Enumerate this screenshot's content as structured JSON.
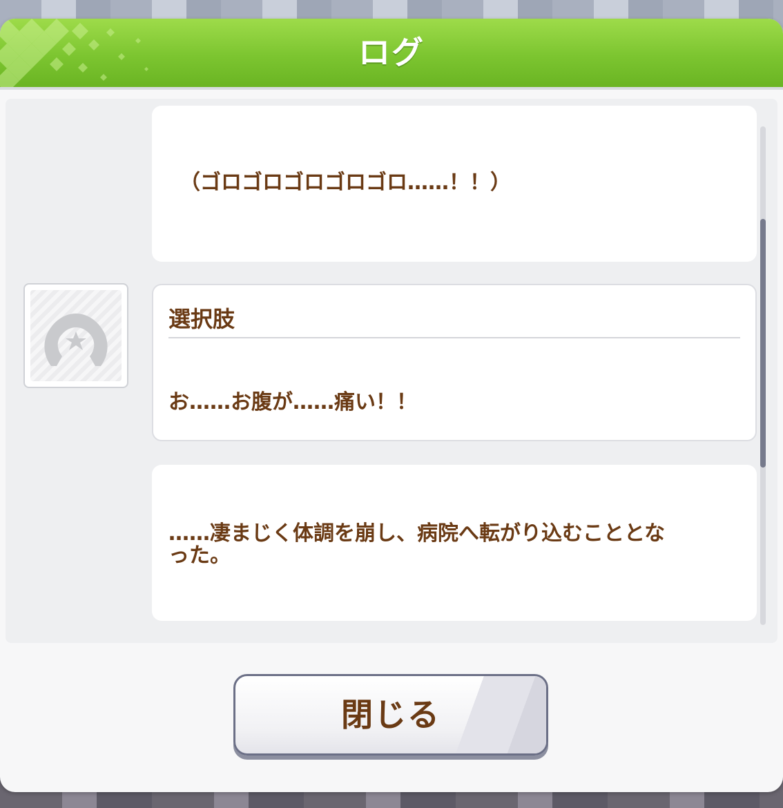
{
  "dialog": {
    "title": "ログ"
  },
  "log": {
    "entries": [
      {
        "type": "narration",
        "text": "（ゴロゴロゴロゴロゴロ……！！）"
      },
      {
        "type": "choice",
        "label": "選択肢",
        "text": "お……お腹が……痛い！！"
      },
      {
        "type": "narration",
        "text": "……凄まじく体調を崩し、病院へ転がり込むこととなった。"
      }
    ]
  },
  "buttons": {
    "close_label": "閉じる"
  },
  "colors": {
    "header_green": "#7cc530",
    "text_brown": "#6a3a14",
    "scroll_thumb": "#767a8c"
  },
  "icons": {
    "avatar": "horseshoe-icon"
  }
}
